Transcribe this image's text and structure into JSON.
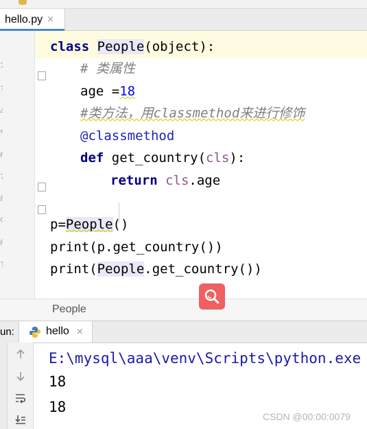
{
  "editor": {
    "file_tab": {
      "label": "hello.py",
      "close": "×"
    },
    "code_lines": {
      "l1": {
        "kw": "class",
        "name": "People",
        "rest": "(object):"
      },
      "l2": {
        "comment": "# 类属性"
      },
      "l3": {
        "name": "age =",
        "value": "18"
      },
      "l4": {
        "comment": "#类方法，用classmethod来进行修饰"
      },
      "l5": {
        "decorator": "@classmethod"
      },
      "l6": {
        "kw": "def",
        "name": " get_country(",
        "param": "cls",
        "rest": "):"
      },
      "l7": {
        "kw": "return",
        "param": "cls",
        "rest": ".age"
      },
      "l8": {
        "pre": "p=",
        "name": "People",
        "rest": "()"
      },
      "l9": {
        "text": "print(p.get_country())"
      },
      "l10": {
        "pre": "print(",
        "name": "People",
        "rest": ".get_country())"
      }
    },
    "breadcrumb": "People"
  },
  "run_panel": {
    "label": "un:",
    "tab": {
      "label": "hello",
      "close": "×"
    },
    "output": [
      "E:\\mysql\\aaa\\venv\\Scripts\\python.exe",
      "18",
      "18"
    ]
  },
  "overlay": {
    "search_icon": "search-icon"
  },
  "watermark": "CSDN @00:00:0079",
  "colors": {
    "keyword": "#000080",
    "number": "#0000ff",
    "comment": "#808080",
    "param": "#94558d",
    "search_button": "#f06060"
  }
}
